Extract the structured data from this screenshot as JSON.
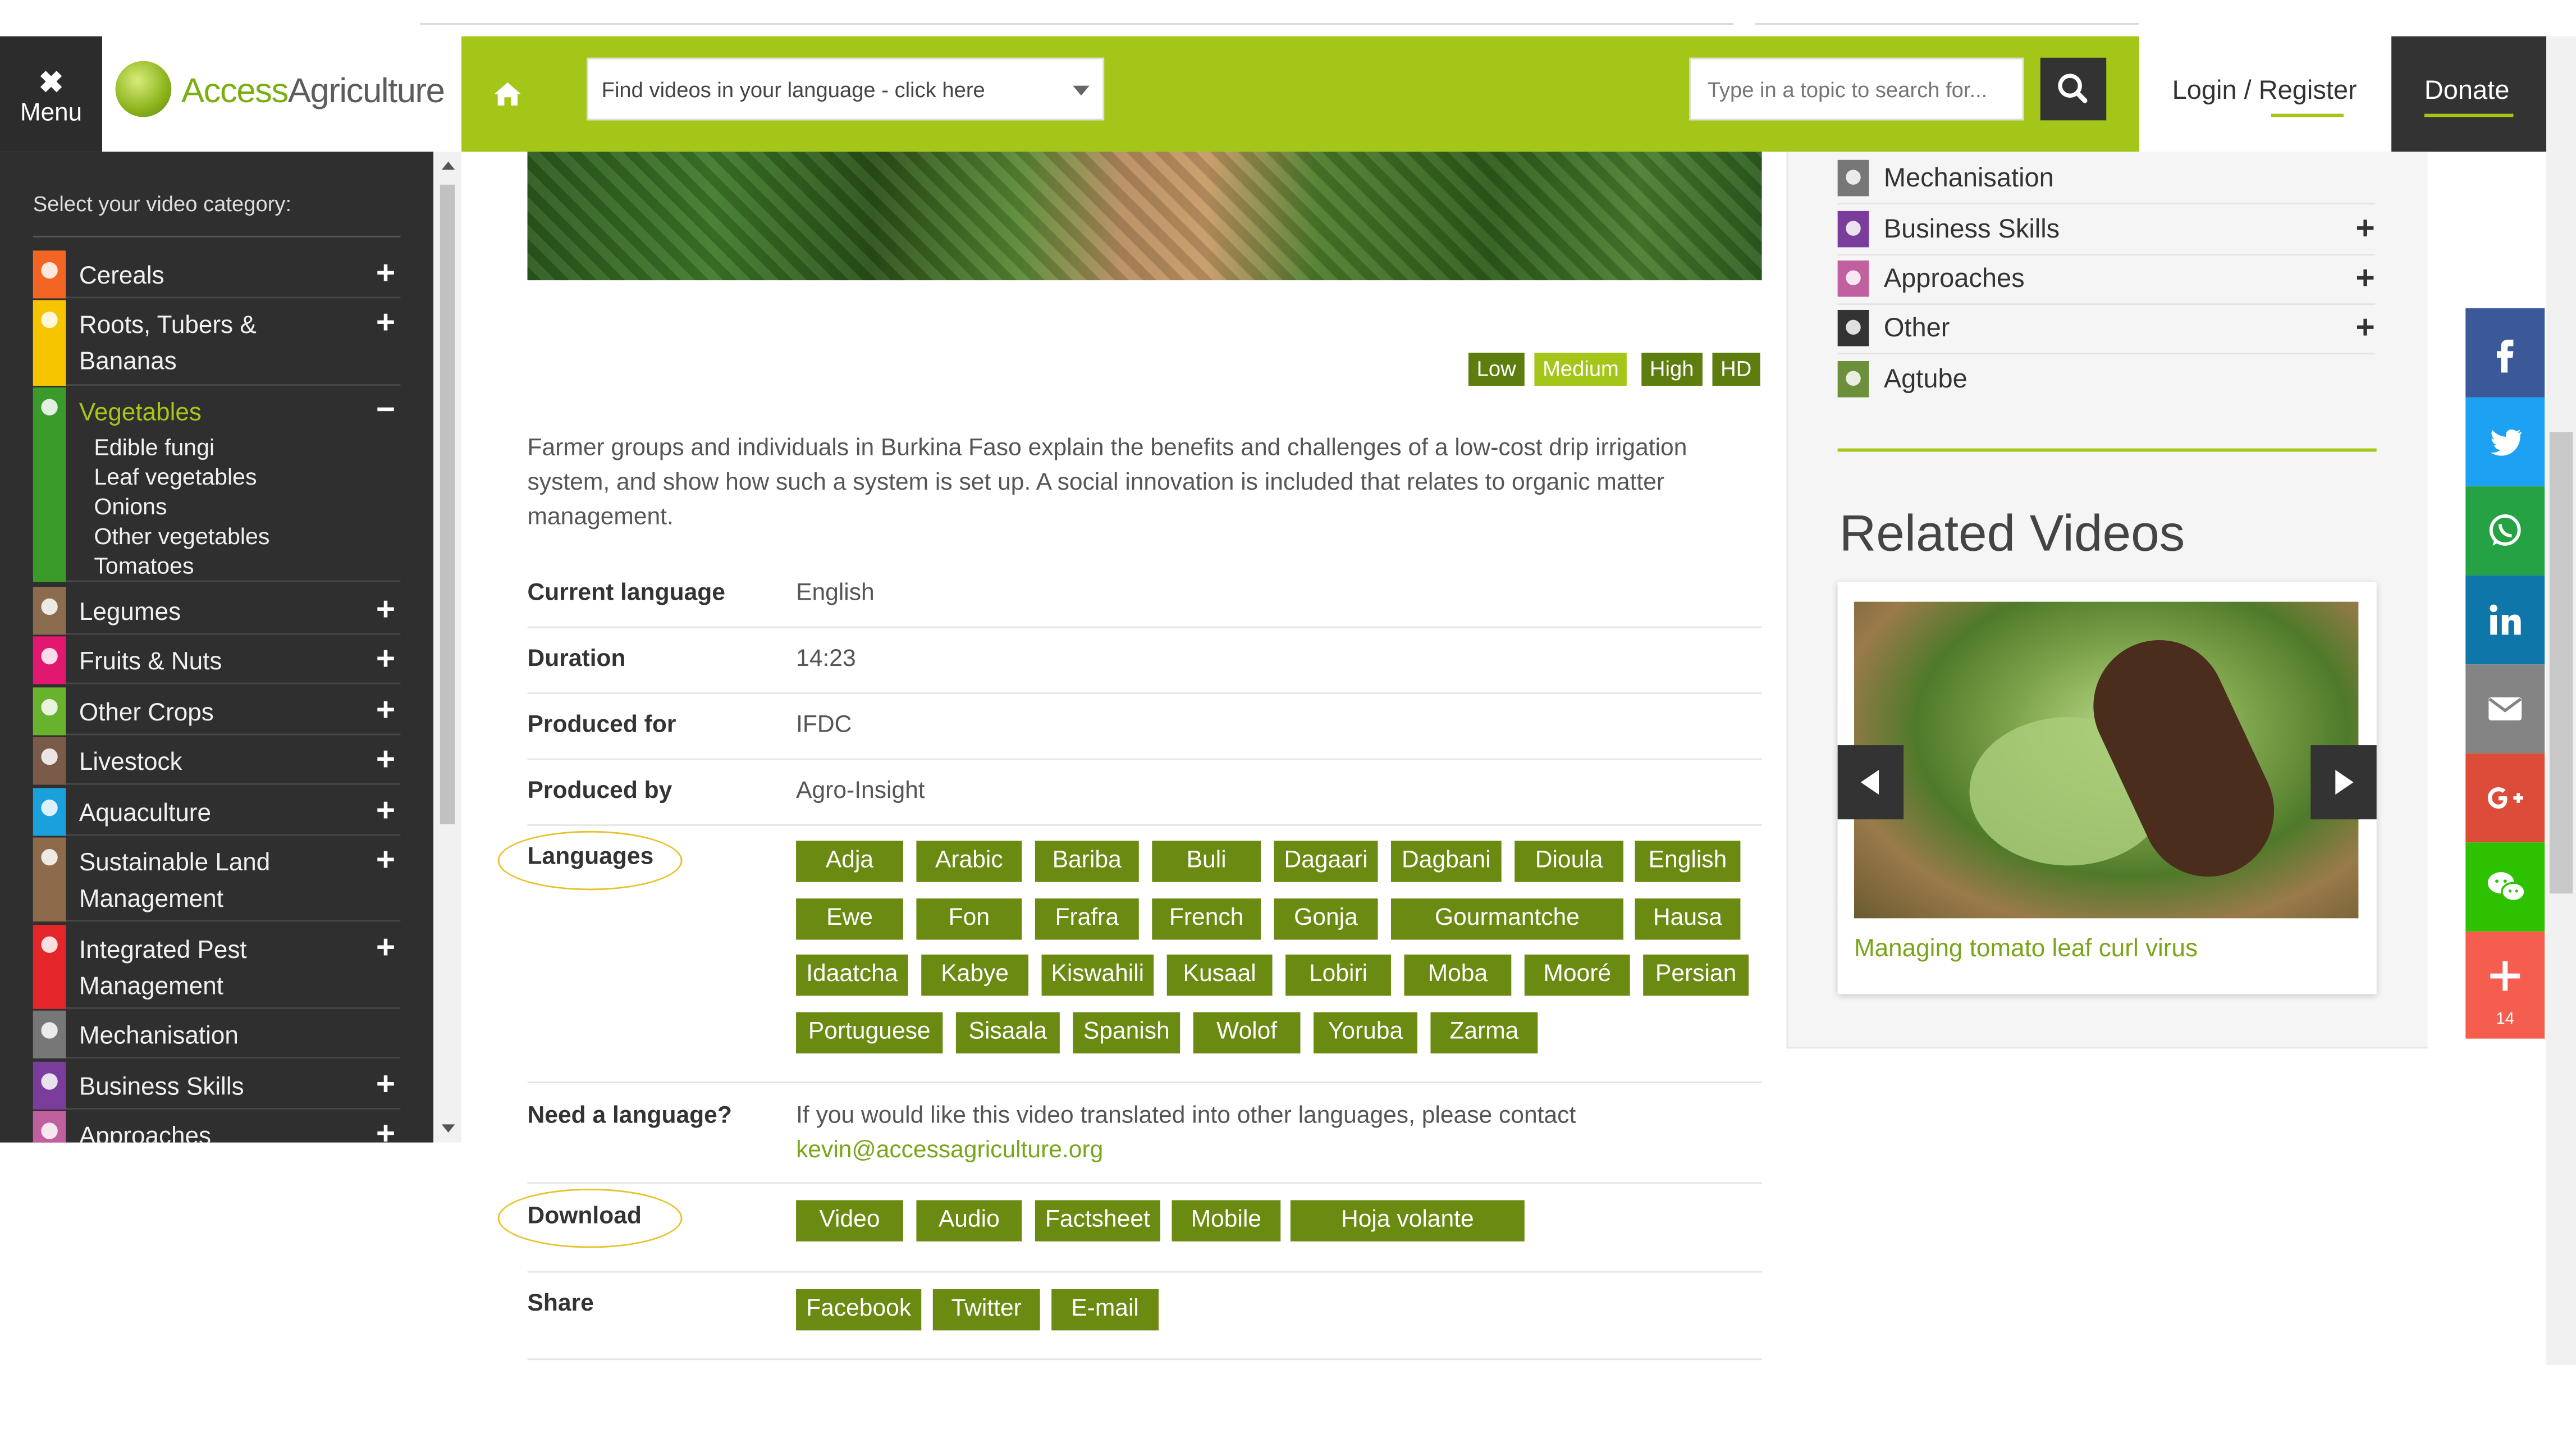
{
  "header": {
    "menu_icon": "✖",
    "menu_label": "Menu",
    "logo_access": "Access",
    "logo_agriculture": "Agriculture",
    "language_select_value": "Find videos in your language - click here",
    "search_placeholder": "Type in a topic to search for...",
    "login": "Login / Register",
    "donate": "Donate"
  },
  "sidebar": {
    "heading": "Select your video category:",
    "categories": [
      {
        "label": "Cereals",
        "toggle": "+",
        "color": "#f26522"
      },
      {
        "label": "Roots, Tubers & Bananas",
        "toggle": "+",
        "color": "#f7c500"
      },
      {
        "label": "Vegetables",
        "toggle": "−",
        "color": "#3a9b2a"
      },
      {
        "label": "Legumes",
        "toggle": "+",
        "color": "#8b6c4e"
      },
      {
        "label": "Fruits & Nuts",
        "toggle": "+",
        "color": "#e2176f"
      },
      {
        "label": "Other Crops",
        "toggle": "+",
        "color": "#68b22e"
      },
      {
        "label": "Livestock",
        "toggle": "+",
        "color": "#7a5a48"
      },
      {
        "label": "Aquaculture",
        "toggle": "+",
        "color": "#1aa0db"
      },
      {
        "label": "Sustainable Land Management",
        "toggle": "+",
        "color": "#8c6a4a"
      },
      {
        "label": "Integrated Pest Management",
        "toggle": "+",
        "color": "#e4262b"
      },
      {
        "label": "Mechanisation",
        "toggle": "",
        "color": "#777777"
      },
      {
        "label": "Business Skills",
        "toggle": "+",
        "color": "#7a3d9c"
      },
      {
        "label": "Approaches",
        "toggle": "+",
        "color": "#c0609e"
      }
    ],
    "vegetable_subcategories": [
      "Edible fungi",
      "Leaf vegetables",
      "Onions",
      "Other vegetables",
      "Tomatoes"
    ]
  },
  "video": {
    "quality_options": [
      "Low",
      "Medium",
      "High",
      "HD"
    ],
    "selected_quality": "Medium",
    "description": "Farmer groups and individuals in Burkina Faso explain the benefits and challenges of a low-cost drip irrigation system, and show how such a system is set up. A social innovation is included that relates to organic matter management.",
    "details": [
      {
        "label": "Current language",
        "value": "English"
      },
      {
        "label": "Duration",
        "value": "14:23"
      },
      {
        "label": "Produced for",
        "value": "IFDC"
      },
      {
        "label": "Produced by",
        "value": "Agro-Insight"
      }
    ],
    "languages_label": "Languages",
    "languages": [
      "Adja",
      "Arabic",
      "Bariba",
      "Buli",
      "Dagaari",
      "Dagbani",
      "Dioula",
      "English",
      "Ewe",
      "Fon",
      "Frafra",
      "French",
      "Gonja",
      "Gourmantche",
      "Hausa",
      "Idaatcha",
      "Kabye",
      "Kiswahili",
      "Kusaal",
      "Lobiri",
      "Moba",
      "Mooré",
      "Persian",
      "Portuguese",
      "Sisaala",
      "Spanish",
      "Wolof",
      "Yoruba",
      "Zarma"
    ],
    "need_language_label": "Need a language?",
    "need_language_text": "If you would like this video translated into other languages, please contact",
    "contact_email": "kevin@accessagriculture.org",
    "download_label": "Download",
    "downloads": [
      "Video",
      "Audio",
      "Factsheet",
      "Mobile",
      "Hoja volante"
    ],
    "share_label": "Share",
    "share_links": [
      "Facebook",
      "Twitter",
      "E-mail"
    ]
  },
  "right_categories": [
    {
      "label": "Mechanisation",
      "toggle": "",
      "color": "#777777"
    },
    {
      "label": "Business Skills",
      "toggle": "+",
      "color": "#7a3d9c"
    },
    {
      "label": "Approaches",
      "toggle": "+",
      "color": "#c0609e"
    },
    {
      "label": "Other",
      "toggle": "+",
      "color": "#333333"
    },
    {
      "label": "Agtube",
      "toggle": "",
      "color": "#6b8f3a"
    }
  ],
  "related": {
    "title": "Related Videos",
    "video_title": "Managing tomato leaf curl virus"
  },
  "share_bar": {
    "buttons": [
      {
        "icon": "facebook-icon",
        "color": "#3b5998"
      },
      {
        "icon": "twitter-icon",
        "color": "#1da1f2"
      },
      {
        "icon": "whatsapp-icon",
        "color": "#25a244"
      },
      {
        "icon": "linkedin-icon",
        "color": "#0e76a8"
      },
      {
        "icon": "email-icon",
        "color": "#848484"
      },
      {
        "icon": "google-plus-icon",
        "color": "#dd4b39"
      },
      {
        "icon": "wechat-icon",
        "color": "#2dc100"
      },
      {
        "icon": "more-share-icon",
        "color": "#f55e4e"
      }
    ],
    "count": "14"
  }
}
